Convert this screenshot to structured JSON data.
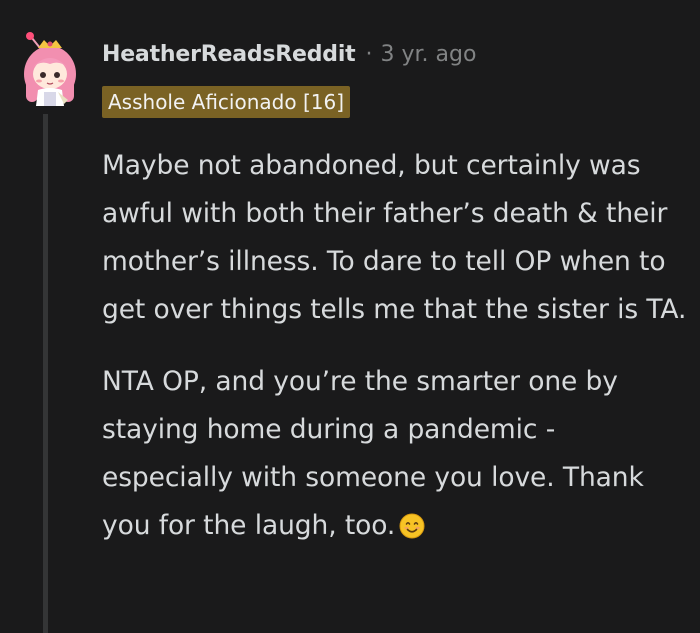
{
  "comment": {
    "username": "HeatherReadsReddit",
    "separator": "·",
    "time": "3 yr. ago",
    "flair": "Asshole Aficionado [16]",
    "paragraphs": [
      "Maybe not abandoned, but certainly was awful with both their father’s death & their mother’s illness. To dare to tell OP when to get over things tells me that the sister is TA.",
      "NTA OP, and you’re the smarter one by staying home during a pandemic - especially with someone you love. Thank you for the laugh, too."
    ],
    "avatar_icon": "snoo-avatar-icon",
    "emoji_icon": "smiling-face-icon"
  },
  "colors": {
    "background": "#1a1a1b",
    "text": "#d7dadc",
    "meta": "#818384",
    "flair_bg": "#7a6224",
    "thread_line": "#343536"
  }
}
